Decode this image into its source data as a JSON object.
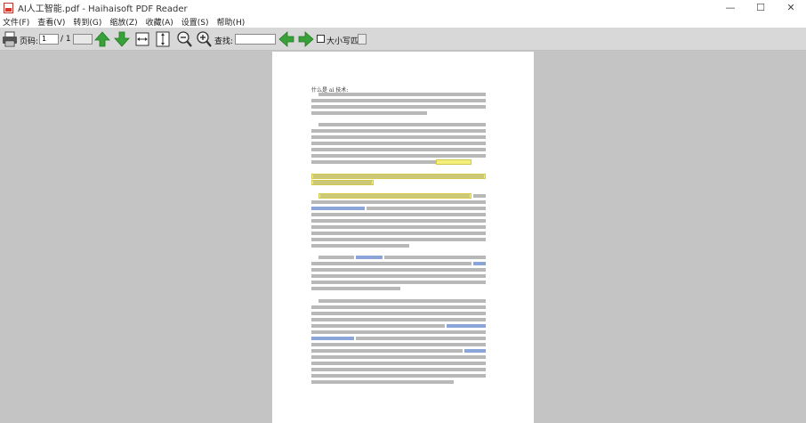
{
  "window": {
    "title": "AI人工智能.pdf - Haihaisoft PDF Reader",
    "minimize_glyph": "—",
    "maximize_glyph": "☐",
    "close_glyph": "✕"
  },
  "menu": {
    "items": [
      "文件(F)",
      "查看(V)",
      "转到(G)",
      "缩放(Z)",
      "收藏(A)",
      "设置(S)",
      "帮助(H)"
    ]
  },
  "toolbar": {
    "page_label": "页码:",
    "page_value": "1",
    "page_total": "/ 1",
    "find_label": "查找:",
    "find_value": "",
    "match_case_label": "大小写匹配",
    "match_case_checked": false,
    "icons": [
      "printer-icon",
      "prev-page-icon",
      "next-page-icon",
      "fit-width-icon",
      "fit-page-icon",
      "zoom-out-icon",
      "zoom-in-icon",
      "find-prev-icon",
      "find-next-icon"
    ],
    "accent_green": "#3aa13a"
  },
  "document": {
    "first_line": "什么是 ai 技术:",
    "highlight_color": "#f4ef7a"
  }
}
